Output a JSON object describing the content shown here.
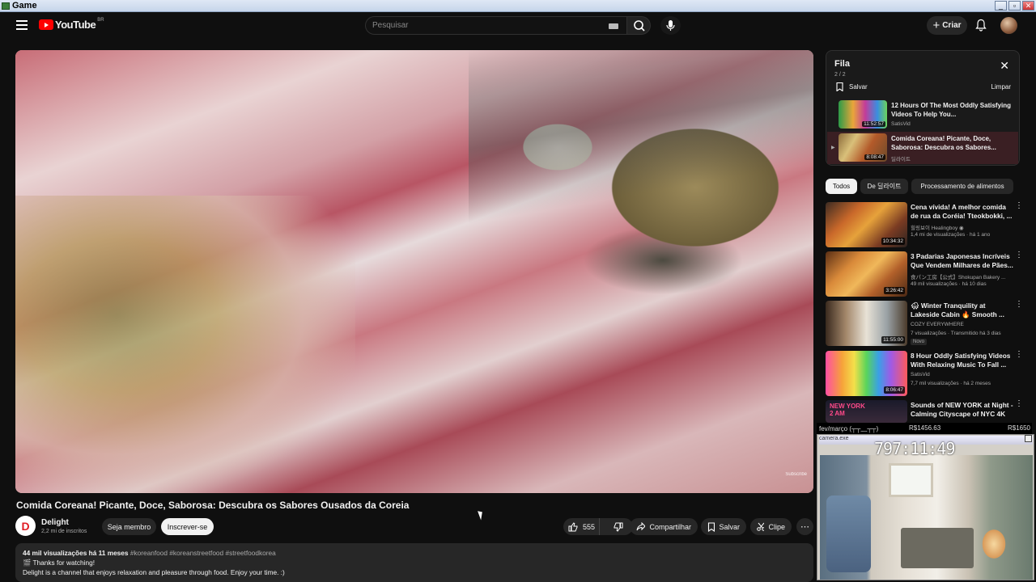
{
  "window": {
    "title": "Game",
    "buttons": [
      "_",
      "▫",
      "✕"
    ]
  },
  "header": {
    "logo_text": "YouTube",
    "country_code": "BR",
    "search_placeholder": "Pesquisar",
    "create_label": "Criar"
  },
  "video": {
    "title": "Comida Coreana! Picante, Doce, Saborosa: Descubra os Sabores Ousados da Coreia",
    "watermark": "Subscribe",
    "channel": {
      "name": "Delight",
      "subscribers": "2,2 mi de inscritos",
      "avatar_letter": "D"
    },
    "member_label": "Seja membro",
    "subscribe_label": "Inscrever-se",
    "likes": "555",
    "share_label": "Compartilhar",
    "save_label": "Salvar",
    "clip_label": "Clipe",
    "description": {
      "stats": "44 mil visualizações  há 11 meses",
      "tags": "#koreanfood #koreanstreetfood #streetfoodkorea",
      "line1": "🎬 Thanks for watching!",
      "line2": "Delight is a channel that enjoys relaxation and pleasure through food. Enjoy your time. :)"
    }
  },
  "queue": {
    "title": "Fila",
    "count": "2 / 2",
    "save_label": "Salvar",
    "clear_label": "Limpar",
    "items": [
      {
        "title": "12 Hours Of The Most Oddly Satisfying Videos To Help You...",
        "channel": "SatisVid",
        "duration": "11:52:57"
      },
      {
        "title": "Comida Coreana! Picante, Doce, Saborosa: Descubra os Sabores...",
        "channel": "딜라이트",
        "duration": "8:08:47"
      }
    ]
  },
  "chips": [
    "Todos",
    "De 딜라이트",
    "Processamento de alimentos"
  ],
  "recommendations": [
    {
      "title": "Cena vívida! A melhor comida de rua da Coréia! Tteokbokki, ...",
      "channel": "힐링보이 Healingboy ◉",
      "meta": "1,4 mi de visualizações · há 1 ano",
      "duration": "10:34:32",
      "badge": ""
    },
    {
      "title": "3 Padarias Japonesas Incríveis Que Vendem Milhares de Pães...",
      "channel": "食パン工房【公式】Shokupan Bakery ...",
      "meta": "49 mil visualizações · há 10 dias",
      "duration": "3:26:42",
      "badge": ""
    },
    {
      "title": "🌨 Winter Tranquility at Lakeside Cabin 🔥 Smooth ...",
      "channel": "COZY EVERYWHERE",
      "meta": "7 visualizações · Transmitido há 3 dias",
      "duration": "11:55:00",
      "badge": "Novo"
    },
    {
      "title": "8 Hour Oddly Satisfying Videos With Relaxing Music To Fall ...",
      "channel": "SatisVid",
      "meta": "7,7 mil visualizações · há 2 meses",
      "duration": "8:06:47",
      "badge": ""
    },
    {
      "title": "Sounds of NEW YORK at Night - Calming Cityscape of NYC 4K",
      "channel": "",
      "meta": "",
      "duration": "",
      "badge": "",
      "thumb_text": "NEW YORK 2 AM"
    }
  ],
  "overlay": {
    "label": "fev/março (┬┬﹏┬┬)",
    "amount1": "R$1456.63",
    "amount2": "R$1650",
    "cam_title": "camera.exe",
    "cam_time": "797:11:49"
  }
}
